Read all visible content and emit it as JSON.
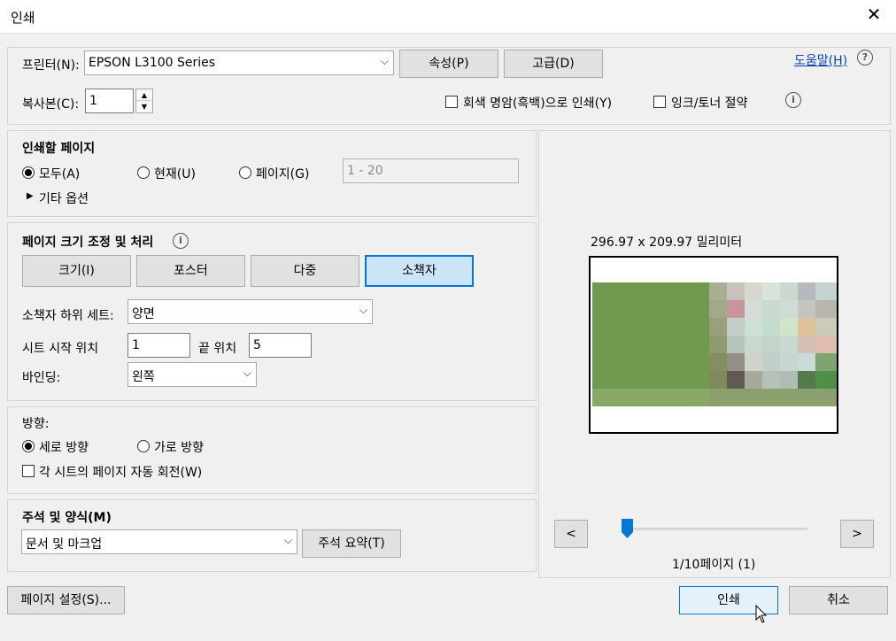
{
  "window": {
    "title": "인쇄",
    "close_glyph": "✕"
  },
  "printer": {
    "label": "프린터(N):",
    "selected": "EPSON L3100 Series",
    "properties_button": "속성(P)",
    "advanced_button": "고급(D)",
    "help_link": "도움말(H)"
  },
  "copies": {
    "label": "복사본(C):",
    "value": "1",
    "grayscale_label": "회색 명암(흑백)으로 인쇄(Y)",
    "grayscale_checked": false,
    "save_ink_label": "잉크/토너 절약",
    "save_ink_checked": false
  },
  "pages_to_print": {
    "heading": "인쇄할 페이지",
    "all_label": "모두(A)",
    "current_label": "현재(U)",
    "pages_label": "페이지(G)",
    "selected": "all",
    "pages_placeholder": "1 - 20",
    "more_options": "기타 옵션"
  },
  "page_sizing": {
    "heading": "페이지 크기 조정 및 처리",
    "tabs": [
      "크기(I)",
      "포스터",
      "다중",
      "소책자"
    ],
    "selected_tab": "소책자",
    "subset_label": "소책자 하위 세트:",
    "subset_value": "양면",
    "sheets_from_label": "시트 시작 위치",
    "sheets_from_value": "1",
    "to_label": "끝 위치",
    "to_value": "5",
    "binding_label": "바인딩:",
    "binding_value": "왼쪽"
  },
  "orientation": {
    "heading": "방향:",
    "portrait_label": "세로 방향",
    "landscape_label": "가로 방향",
    "selected": "portrait",
    "auto_rotate_label": "각 시트의 페이지 자동 회전(W)",
    "auto_rotate_checked": false
  },
  "comments": {
    "heading": "주석 및 양식(M)",
    "selected": "문서 및 마크업",
    "summarize_button": "주석 요약(T)"
  },
  "preview": {
    "dimensions": "296.97 x 209.97 밀리미터",
    "prev_button": "<",
    "next_button": ">",
    "page_status": "1/10페이지 (1)",
    "page_position": 0.0
  },
  "footer": {
    "page_setup_button": "페이지 설정(S)...",
    "print_button": "인쇄",
    "cancel_button": "취소"
  },
  "icons": {
    "help": "question-circle-icon",
    "info": "info-circle-icon",
    "dropdown": "chevron-down-icon",
    "expand": "triangle-right-icon"
  },
  "colors": {
    "accent": "#0078d7",
    "link": "#0645ad"
  }
}
